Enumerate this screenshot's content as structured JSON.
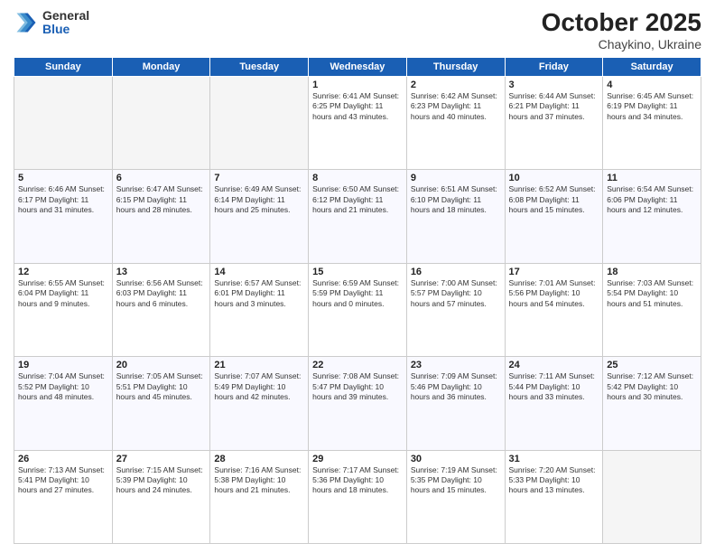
{
  "header": {
    "logo_general": "General",
    "logo_blue": "Blue",
    "month": "October 2025",
    "location": "Chaykino, Ukraine"
  },
  "days_of_week": [
    "Sunday",
    "Monday",
    "Tuesday",
    "Wednesday",
    "Thursday",
    "Friday",
    "Saturday"
  ],
  "weeks": [
    [
      {
        "day": "",
        "info": ""
      },
      {
        "day": "",
        "info": ""
      },
      {
        "day": "",
        "info": ""
      },
      {
        "day": "1",
        "info": "Sunrise: 6:41 AM\nSunset: 6:25 PM\nDaylight: 11 hours\nand 43 minutes."
      },
      {
        "day": "2",
        "info": "Sunrise: 6:42 AM\nSunset: 6:23 PM\nDaylight: 11 hours\nand 40 minutes."
      },
      {
        "day": "3",
        "info": "Sunrise: 6:44 AM\nSunset: 6:21 PM\nDaylight: 11 hours\nand 37 minutes."
      },
      {
        "day": "4",
        "info": "Sunrise: 6:45 AM\nSunset: 6:19 PM\nDaylight: 11 hours\nand 34 minutes."
      }
    ],
    [
      {
        "day": "5",
        "info": "Sunrise: 6:46 AM\nSunset: 6:17 PM\nDaylight: 11 hours\nand 31 minutes."
      },
      {
        "day": "6",
        "info": "Sunrise: 6:47 AM\nSunset: 6:15 PM\nDaylight: 11 hours\nand 28 minutes."
      },
      {
        "day": "7",
        "info": "Sunrise: 6:49 AM\nSunset: 6:14 PM\nDaylight: 11 hours\nand 25 minutes."
      },
      {
        "day": "8",
        "info": "Sunrise: 6:50 AM\nSunset: 6:12 PM\nDaylight: 11 hours\nand 21 minutes."
      },
      {
        "day": "9",
        "info": "Sunrise: 6:51 AM\nSunset: 6:10 PM\nDaylight: 11 hours\nand 18 minutes."
      },
      {
        "day": "10",
        "info": "Sunrise: 6:52 AM\nSunset: 6:08 PM\nDaylight: 11 hours\nand 15 minutes."
      },
      {
        "day": "11",
        "info": "Sunrise: 6:54 AM\nSunset: 6:06 PM\nDaylight: 11 hours\nand 12 minutes."
      }
    ],
    [
      {
        "day": "12",
        "info": "Sunrise: 6:55 AM\nSunset: 6:04 PM\nDaylight: 11 hours\nand 9 minutes."
      },
      {
        "day": "13",
        "info": "Sunrise: 6:56 AM\nSunset: 6:03 PM\nDaylight: 11 hours\nand 6 minutes."
      },
      {
        "day": "14",
        "info": "Sunrise: 6:57 AM\nSunset: 6:01 PM\nDaylight: 11 hours\nand 3 minutes."
      },
      {
        "day": "15",
        "info": "Sunrise: 6:59 AM\nSunset: 5:59 PM\nDaylight: 11 hours\nand 0 minutes."
      },
      {
        "day": "16",
        "info": "Sunrise: 7:00 AM\nSunset: 5:57 PM\nDaylight: 10 hours\nand 57 minutes."
      },
      {
        "day": "17",
        "info": "Sunrise: 7:01 AM\nSunset: 5:56 PM\nDaylight: 10 hours\nand 54 minutes."
      },
      {
        "day": "18",
        "info": "Sunrise: 7:03 AM\nSunset: 5:54 PM\nDaylight: 10 hours\nand 51 minutes."
      }
    ],
    [
      {
        "day": "19",
        "info": "Sunrise: 7:04 AM\nSunset: 5:52 PM\nDaylight: 10 hours\nand 48 minutes."
      },
      {
        "day": "20",
        "info": "Sunrise: 7:05 AM\nSunset: 5:51 PM\nDaylight: 10 hours\nand 45 minutes."
      },
      {
        "day": "21",
        "info": "Sunrise: 7:07 AM\nSunset: 5:49 PM\nDaylight: 10 hours\nand 42 minutes."
      },
      {
        "day": "22",
        "info": "Sunrise: 7:08 AM\nSunset: 5:47 PM\nDaylight: 10 hours\nand 39 minutes."
      },
      {
        "day": "23",
        "info": "Sunrise: 7:09 AM\nSunset: 5:46 PM\nDaylight: 10 hours\nand 36 minutes."
      },
      {
        "day": "24",
        "info": "Sunrise: 7:11 AM\nSunset: 5:44 PM\nDaylight: 10 hours\nand 33 minutes."
      },
      {
        "day": "25",
        "info": "Sunrise: 7:12 AM\nSunset: 5:42 PM\nDaylight: 10 hours\nand 30 minutes."
      }
    ],
    [
      {
        "day": "26",
        "info": "Sunrise: 7:13 AM\nSunset: 5:41 PM\nDaylight: 10 hours\nand 27 minutes."
      },
      {
        "day": "27",
        "info": "Sunrise: 7:15 AM\nSunset: 5:39 PM\nDaylight: 10 hours\nand 24 minutes."
      },
      {
        "day": "28",
        "info": "Sunrise: 7:16 AM\nSunset: 5:38 PM\nDaylight: 10 hours\nand 21 minutes."
      },
      {
        "day": "29",
        "info": "Sunrise: 7:17 AM\nSunset: 5:36 PM\nDaylight: 10 hours\nand 18 minutes."
      },
      {
        "day": "30",
        "info": "Sunrise: 7:19 AM\nSunset: 5:35 PM\nDaylight: 10 hours\nand 15 minutes."
      },
      {
        "day": "31",
        "info": "Sunrise: 7:20 AM\nSunset: 5:33 PM\nDaylight: 10 hours\nand 13 minutes."
      },
      {
        "day": "",
        "info": ""
      }
    ]
  ]
}
